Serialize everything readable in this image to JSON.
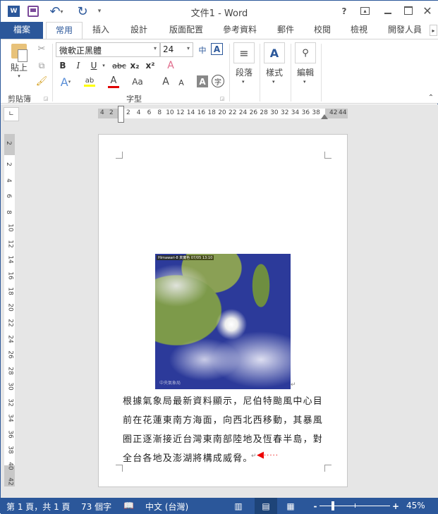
{
  "window": {
    "title": "文件1 - Word",
    "help": "?",
    "icons": [
      "word-icon",
      "save-icon",
      "undo-icon",
      "redo-icon",
      "customize-qat-icon",
      "help-icon",
      "ribbon-display-icon",
      "minimize-icon",
      "maximize-icon",
      "close-icon"
    ]
  },
  "tabs": [
    {
      "label": "檔案"
    },
    {
      "label": "常用",
      "active": true
    },
    {
      "label": "插入"
    },
    {
      "label": "設計"
    },
    {
      "label": "版面配置"
    },
    {
      "label": "參考資料"
    },
    {
      "label": "郵件"
    },
    {
      "label": "校閱"
    },
    {
      "label": "檢視"
    },
    {
      "label": "開發人員"
    }
  ],
  "ribbon": {
    "clipboard": {
      "paste": "貼上",
      "group": "剪貼簿"
    },
    "font": {
      "name": "微軟正黑體",
      "size": "24",
      "bold": "B",
      "italic": "I",
      "underline": "U",
      "strike": "abc",
      "sub": "x₂",
      "sup": "x²",
      "case": "Aa",
      "group": "字型",
      "highlight_color": "#ffff00",
      "font_color": "#e00000"
    },
    "paragraph": {
      "label": "段落"
    },
    "styles": {
      "label": "樣式"
    },
    "editing": {
      "label": "編輯"
    }
  },
  "ruler": {
    "left_gray": [
      "4",
      "2"
    ],
    "ticks": [
      "2",
      "4",
      "6",
      "8",
      "10",
      "12",
      "14",
      "16",
      "18",
      "20",
      "22",
      "24",
      "26",
      "28",
      "30",
      "32",
      "34",
      "36",
      "38"
    ],
    "right_gray": [
      "42",
      "44"
    ],
    "vertical": [
      "2",
      "2",
      "4",
      "6",
      "8",
      "10",
      "12",
      "14",
      "16",
      "18",
      "20",
      "22",
      "24",
      "26",
      "28",
      "30",
      "32",
      "34",
      "36",
      "38",
      "40",
      "42"
    ]
  },
  "document": {
    "lines": [
      "根據氣象局最新資料顯示，尼伯特颱風中心目",
      "前在花蓮東南方海面，向西北西移動，其暴風",
      "圈正逐漸接近台灣東南部陸地及恆春半島，對",
      "全台各地及澎湖將構成威脅。"
    ],
    "image_caption": "Himawari-8 真實色 07/05 13:10",
    "image_watermark": "中央氣象局"
  },
  "status": {
    "page": "第 1 頁，共 1 頁",
    "words": "73 個字",
    "language": "中文 (台灣)",
    "zoom": "45%",
    "zoom_level": 45,
    "accent": "#2b579a"
  }
}
